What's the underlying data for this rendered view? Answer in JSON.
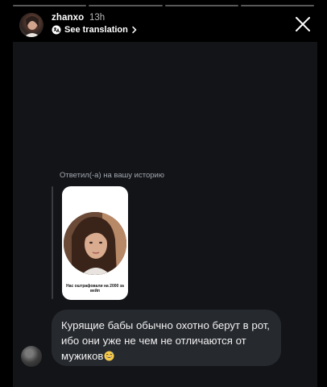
{
  "header": {
    "username": "zhanxo",
    "time": "13h",
    "translate_label": "See translation"
  },
  "progress": {
    "segments_total": 4,
    "segments_done": 0
  },
  "reply": {
    "label": "Ответил(-а) на вашу историю",
    "story_caption": "Нас оштрафовали на 2000 за вейп"
  },
  "message": {
    "text": "Курящие бабы обычно охотно берут в рот, ибо они уже не чем не отличаются от мужиков",
    "emoji": "grinning-sweat-emoji"
  },
  "colors": {
    "background": "#000000",
    "panel": "#121418",
    "bubble": "#26292e",
    "secondary_text": "#a3a7ae"
  }
}
